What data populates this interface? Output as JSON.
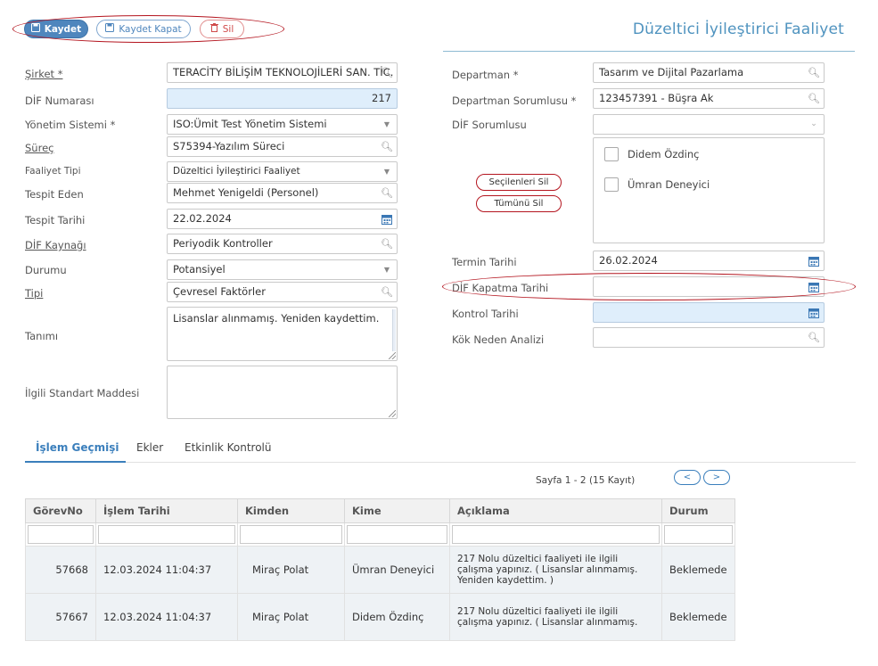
{
  "toolbar": {
    "save_label": "Kaydet",
    "save_close_label": "Kaydet Kapat",
    "delete_label": "Sil"
  },
  "page_title": "Düzeltici İyileştirici Faaliyet",
  "left_form": {
    "sirket": {
      "label": "Şirket *",
      "value": "TERACİTY BİLİŞİM TEKNOLOJİLERİ SAN. TİC. A.Ş."
    },
    "dif_numarasi": {
      "label": "DİF Numarası",
      "value": "217"
    },
    "yonetim_sistemi": {
      "label": "Yönetim Sistemi *",
      "value": "ISO:Ümit Test Yönetim Sistemi"
    },
    "surec": {
      "label": "Süreç",
      "value": "S75394-Yazılım Süreci"
    },
    "faaliyet_tipi": {
      "label": "Faaliyet Tipi",
      "value": "Düzeltici İyileştirici Faaliyet"
    },
    "tespit_eden": {
      "label": "Tespit Eden",
      "value": "Mehmet Yenigeldi (Personel)"
    },
    "tespit_tarihi": {
      "label": "Tespit Tarihi",
      "value": "22.02.2024"
    },
    "dif_kaynagi": {
      "label": "DİF Kaynağı",
      "value": "Periyodik Kontroller"
    },
    "durumu": {
      "label": "Durumu",
      "value": "Potansiyel"
    },
    "tipi": {
      "label": "Tipi",
      "value": "Çevresel Faktörler"
    },
    "tanimi": {
      "label": "Tanımı",
      "value": "Lisanslar alınmamış. Yeniden kaydettim."
    },
    "ilgili_standart": {
      "label": "İlgili Standart Maddesi",
      "value": ""
    }
  },
  "right_form": {
    "departman": {
      "label": "Departman *",
      "value": "Tasarım ve Dijital Pazarlama"
    },
    "departman_sorumlusu": {
      "label": "Departman Sorumlusu *",
      "value": "123457391 - Büşra Ak"
    },
    "dif_sorumlusu": {
      "label": "DİF Sorumlusu",
      "value": ""
    },
    "sorumlu_list": [
      "Didem Özdinç",
      "Ümran Deneyici"
    ],
    "remove_selected_label": "Seçilenleri Sil",
    "remove_all_label": "Tümünü Sil",
    "termin_tarihi": {
      "label": "Termin Tarihi",
      "value": "26.02.2024"
    },
    "dif_kapatma_tarihi": {
      "label": "DİF Kapatma Tarihi",
      "value": ""
    },
    "kontrol_tarihi": {
      "label": "Kontrol Tarihi",
      "value": ""
    },
    "kok_neden_analizi": {
      "label": "Kök Neden Analizi",
      "value": ""
    }
  },
  "tabs": [
    {
      "label": "İşlem Geçmişi",
      "active": true
    },
    {
      "label": "Ekler",
      "active": false
    },
    {
      "label": "Etkinlik Kontrolü",
      "active": false
    }
  ],
  "pager": {
    "text": "Sayfa 1 - 2 (15 Kayıt)",
    "prev": "<",
    "next": ">"
  },
  "table": {
    "headers": [
      "GörevNo",
      "İşlem Tarihi",
      "Kimden",
      "Kime",
      "Açıklama",
      "Durum"
    ],
    "rows": [
      {
        "gorev_no": "57668",
        "tarih": "12.03.2024 11:04:37",
        "kimden": "Miraç Polat",
        "kime": "Ümran Deneyici",
        "aciklama": "217 Nolu düzeltici faaliyeti ile ilgili çalışma yapınız. ( Lisanslar alınmamış. Yeniden kaydettim. )",
        "durum": "Beklemede"
      },
      {
        "gorev_no": "57667",
        "tarih": "12.03.2024 11:04:37",
        "kimden": "Miraç Polat",
        "kime": "Didem Özdinç",
        "aciklama": "217 Nolu düzeltici faaliyeti ile ilgili çalışma yapınız. ( Lisanslar alınmamış.",
        "durum": "Beklemede"
      }
    ]
  },
  "colors": {
    "accent": "#4f86bd",
    "annotation": "#b4151f",
    "title": "#4f93bf"
  }
}
